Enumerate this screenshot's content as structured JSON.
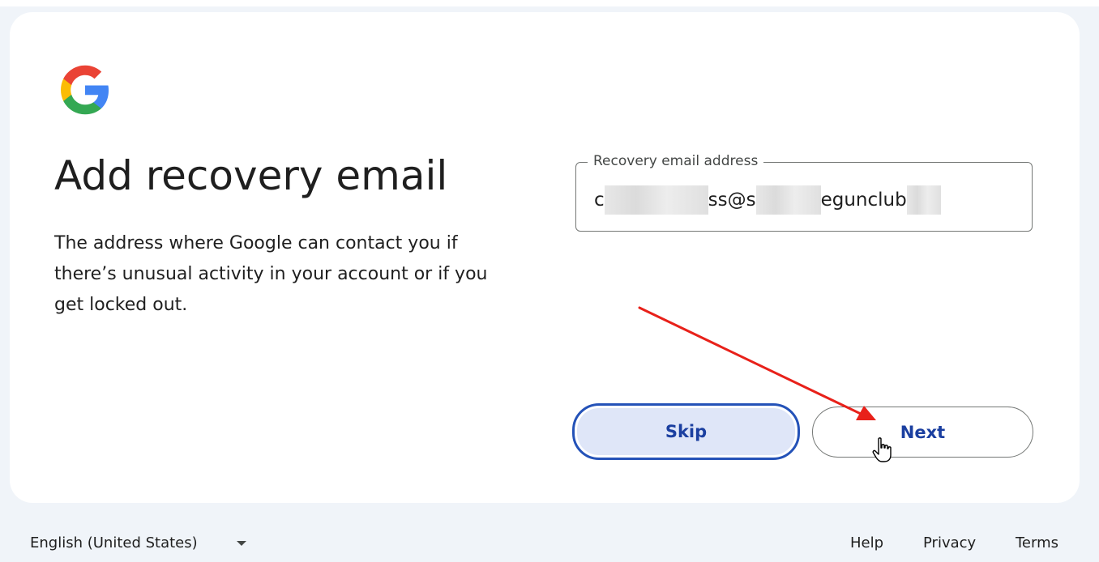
{
  "logo": {
    "icon": "google-g-logo",
    "colors": [
      "#ea4335",
      "#fbbc05",
      "#34a853",
      "#4285f4"
    ]
  },
  "title": "Add recovery email",
  "description": "The address where Google can contact you if there’s unusual activity in your account or if you get locked out.",
  "field": {
    "label": "Recovery email address",
    "value_parts": [
      "c",
      "ss@s",
      "egunclub"
    ]
  },
  "buttons": {
    "skip": "Skip",
    "next": "Next"
  },
  "annotation": {
    "icon": "red-arrow-icon",
    "color": "#e8211a"
  },
  "footer": {
    "language": "English (United States)",
    "help": "Help",
    "privacy": "Privacy",
    "terms": "Terms"
  },
  "colors": {
    "accent": "#0b57d0",
    "button_text": "#1b3fa0",
    "page_bg": "#f0f4f9"
  }
}
